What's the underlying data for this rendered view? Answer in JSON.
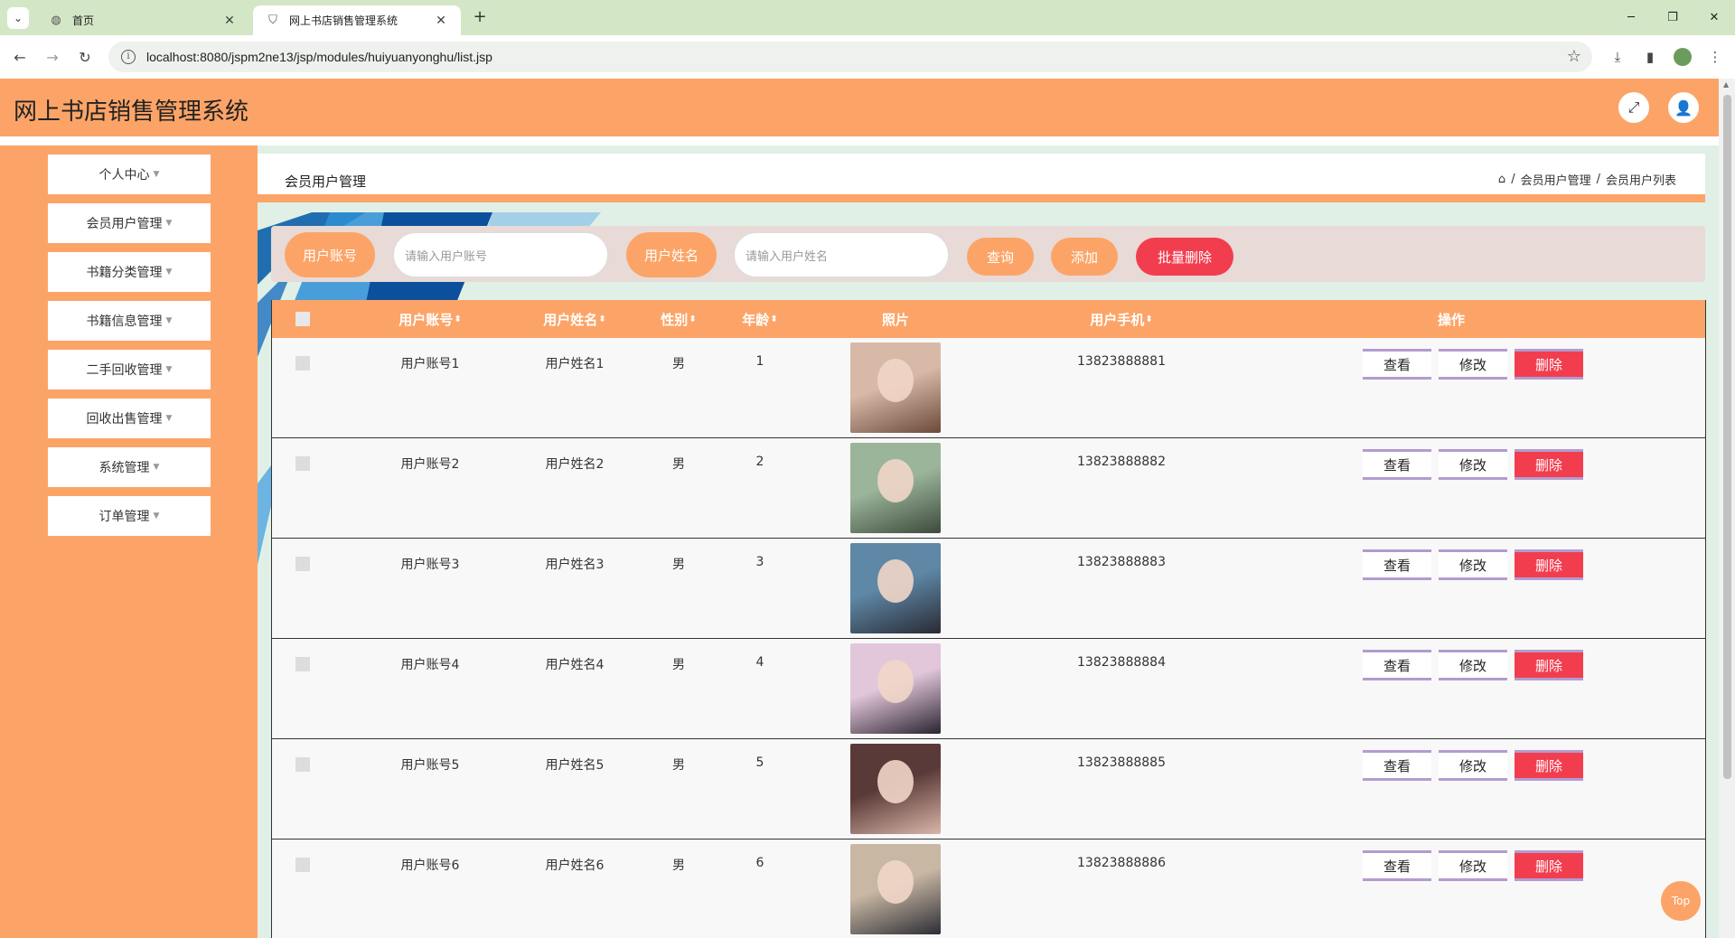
{
  "browser": {
    "tabs": [
      {
        "title": "首页",
        "active": false
      },
      {
        "title": "网上书店销售管理系统",
        "active": true
      }
    ],
    "url": "localhost:8080/jspm2ne13/jsp/modules/huiyuanyonghu/list.jsp"
  },
  "app": {
    "title": "网上书店销售管理系统",
    "header_icons": [
      "fullscreen-icon",
      "user-icon"
    ]
  },
  "sidebar": {
    "items": [
      {
        "label": "个人中心"
      },
      {
        "label": "会员用户管理"
      },
      {
        "label": "书籍分类管理"
      },
      {
        "label": "书籍信息管理"
      },
      {
        "label": "二手回收管理"
      },
      {
        "label": "回收出售管理"
      },
      {
        "label": "系统管理"
      },
      {
        "label": "订单管理"
      }
    ]
  },
  "page": {
    "title": "会员用户管理",
    "breadcrumb": [
      "会员用户管理",
      "会员用户列表"
    ],
    "breadcrumb_sep": "/"
  },
  "search": {
    "account_label": "用户账号",
    "account_placeholder": "请输入用户账号",
    "name_label": "用户姓名",
    "name_placeholder": "请输入用户姓名",
    "query_btn": "查询",
    "add_btn": "添加",
    "batch_delete_btn": "批量删除"
  },
  "table": {
    "headers": {
      "account": "用户账号",
      "name": "用户姓名",
      "gender": "性别",
      "age": "年龄",
      "photo": "照片",
      "phone": "用户手机",
      "ops": "操作"
    },
    "actions": {
      "view": "查看",
      "edit": "修改",
      "delete": "删除"
    },
    "rows": [
      {
        "account": "用户账号1",
        "name": "用户姓名1",
        "gender": "男",
        "age": "1",
        "phone": "13823888881"
      },
      {
        "account": "用户账号2",
        "name": "用户姓名2",
        "gender": "男",
        "age": "2",
        "phone": "13823888882"
      },
      {
        "account": "用户账号3",
        "name": "用户姓名3",
        "gender": "男",
        "age": "3",
        "phone": "13823888883"
      },
      {
        "account": "用户账号4",
        "name": "用户姓名4",
        "gender": "男",
        "age": "4",
        "phone": "13823888884"
      },
      {
        "account": "用户账号5",
        "name": "用户姓名5",
        "gender": "男",
        "age": "5",
        "phone": "13823888885"
      },
      {
        "account": "用户账号6",
        "name": "用户姓名6",
        "gender": "男",
        "age": "6",
        "phone": "13823888886"
      }
    ]
  },
  "top_button": "Top",
  "colors": {
    "accent": "#fca467",
    "danger": "#f23d4f",
    "tab_bar": "#d3e7c6",
    "content_bg": "#e0f0e6"
  }
}
